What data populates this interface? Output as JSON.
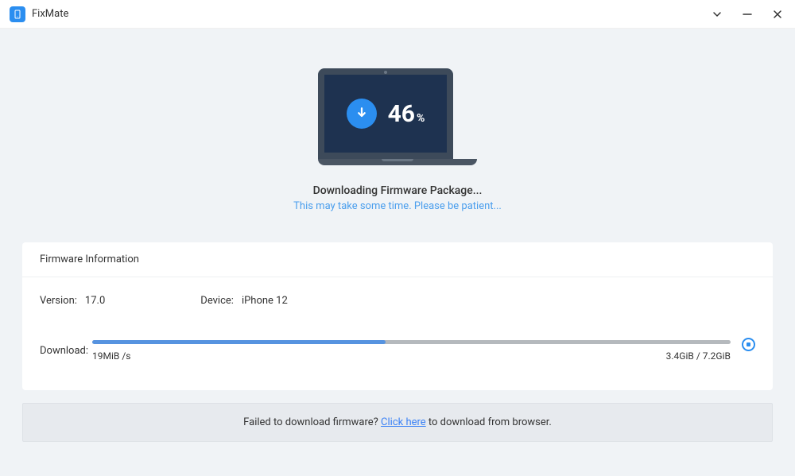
{
  "app": {
    "title": "FixMate"
  },
  "progress": {
    "percent": "46",
    "percent_sign": "%",
    "fill_pct": "46%"
  },
  "status": {
    "title": "Downloading Firmware Package...",
    "subtitle": "This may take some time. Please be patient..."
  },
  "panel": {
    "header": "Firmware Information",
    "version_label": "Version:",
    "version_value": "17.0",
    "device_label": "Device:",
    "device_value": "iPhone 12",
    "download_label": "Download:",
    "speed": "19MiB /s",
    "size": "3.4GiB / 7.2GiB"
  },
  "footer": {
    "prefix": "Failed to download firmware? ",
    "link": "Click here",
    "suffix": " to download from browser."
  },
  "colors": {
    "accent": "#2b8ef0",
    "screen": "#1e3250"
  }
}
